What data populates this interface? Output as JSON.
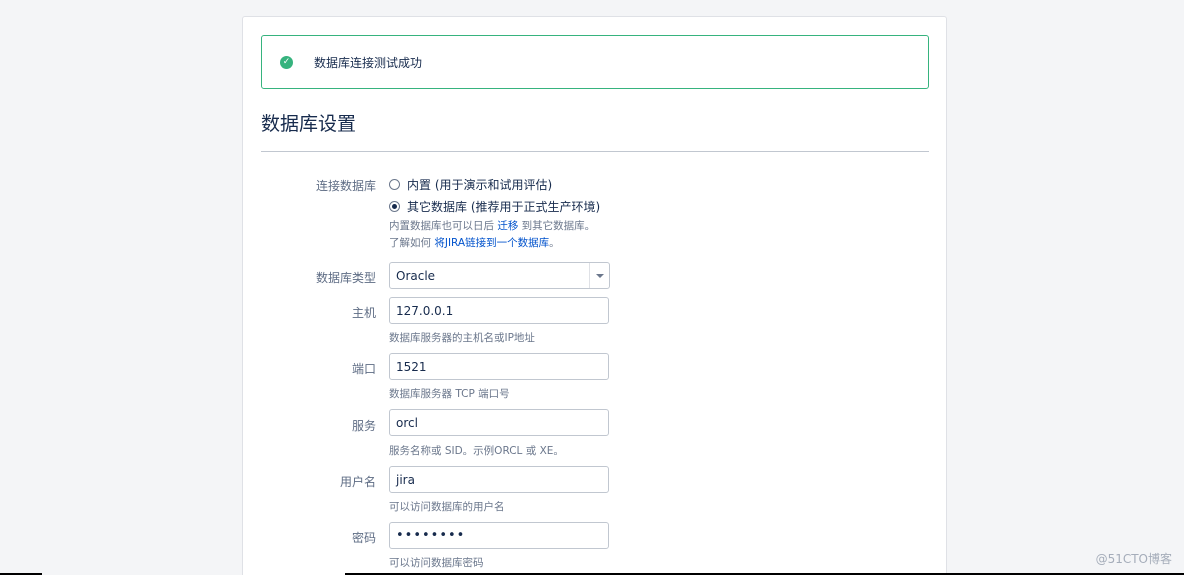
{
  "banner": {
    "message": "数据库连接测试成功",
    "icon": "check-circle-icon"
  },
  "section": {
    "title": "数据库设置"
  },
  "connection": {
    "label": "连接数据库",
    "options": [
      {
        "label": "内置 (用于演示和试用评估)",
        "selected": false
      },
      {
        "label": "其它数据库 (推荐用于正式生产环境)",
        "selected": true
      }
    ],
    "help1_pre": "内置数据库也可以日后 ",
    "help1_link": "迁移",
    "help1_post": " 到其它数据库。",
    "help2_pre": "了解如何 ",
    "help2_link": "将JIRA链接到一个数据库",
    "help2_post": "。"
  },
  "db_type": {
    "label": "数据库类型",
    "value": "Oracle"
  },
  "host": {
    "label": "主机",
    "value": "127.0.0.1",
    "help": "数据库服务器的主机名或IP地址"
  },
  "port": {
    "label": "端口",
    "value": "1521",
    "help": "数据库服务器 TCP 端口号"
  },
  "service": {
    "label": "服务",
    "value": "orcl",
    "help": "服务名称或 SID。示例ORCL 或 XE。"
  },
  "username": {
    "label": "用户名",
    "value": "jira",
    "help": "可以访问数据库的用户名"
  },
  "password": {
    "label": "密码",
    "value": "••••••••",
    "help": "可以访问数据库密码"
  },
  "watermark": "@51CTO博客",
  "colors": {
    "success": "#36b37e",
    "link": "#0052cc",
    "text": "#172b4d"
  }
}
